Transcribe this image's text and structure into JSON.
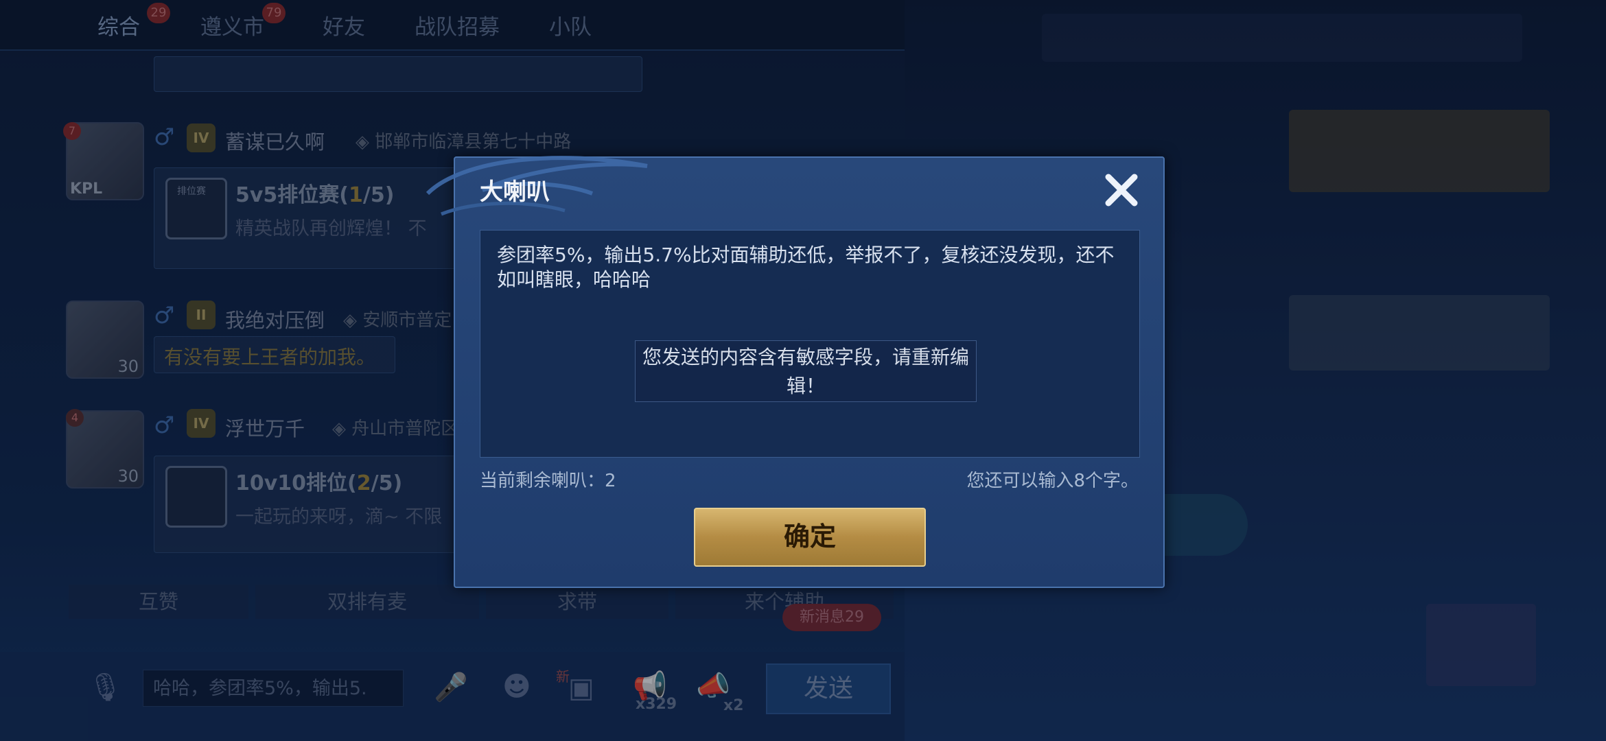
{
  "chat_tabs": [
    {
      "label": "综合",
      "badge": "29"
    },
    {
      "label": "遵义市",
      "badge": "79"
    },
    {
      "label": "好友",
      "badge": ""
    },
    {
      "label": "战队招募",
      "badge": ""
    },
    {
      "label": "小队",
      "badge": ""
    }
  ],
  "messages": [
    {
      "avatar_level": "7",
      "avatar_tag": "KPL",
      "rank": "IV",
      "username": "蓄谋已久啊",
      "location": "邯郸市临漳县第七十中路",
      "card_title_prefix": "5v5排位赛(",
      "card_title_highlight": "1",
      "card_title_suffix": "/5)",
      "card_sub": "精英战队再创辉煌！ 不",
      "card_tag": "排位赛"
    },
    {
      "avatar_level": "30",
      "rank": "II",
      "username": "我绝对压倒",
      "location": "安顺市普定",
      "bubble": "有没有要上王者的加我。"
    },
    {
      "avatar_level": "30",
      "avatar_badge": "4",
      "rank": "IV",
      "username": "浮世万千",
      "location": "舟山市普陀区",
      "card_title_prefix": "10v10排位(",
      "card_title_highlight": "2",
      "card_title_suffix": "/5)",
      "card_sub": "一起玩的来呀，滴~ 不限"
    }
  ],
  "quick_replies": [
    "互赞",
    "双排有麦",
    "求带",
    "来个辅助"
  ],
  "new_messages_badge": "新消息29",
  "bottom_bar": {
    "input_value": "哈哈，参团率5%，输出5.",
    "small_horn_count": "x329",
    "big_horn_count": "x2",
    "new_tag": "新",
    "send_label": "发送"
  },
  "dialog": {
    "title": "大喇叭",
    "message": "参团率5%，输出5.7%比对面辅助还低，举报不了，复核还没发现，还不如叫瞎眼，哈哈哈",
    "toast": "您发送的内容含有敏感字段，请重新编辑！",
    "remaining_label": "当前剩余喇叭：2",
    "chars_left_label": "您还可以输入8个字。",
    "confirm_label": "确定"
  },
  "colors": {
    "dialog_bg": "#23426f",
    "confirm_gold": "#c9a457",
    "accent_blue": "#3f6fb1"
  }
}
